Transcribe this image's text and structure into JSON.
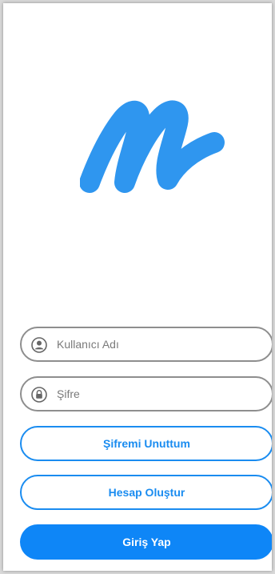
{
  "app": {
    "logo_icon": "m-logo-icon",
    "brand_color": "#2f96ef"
  },
  "login_form": {
    "username": {
      "placeholder": "Kullanıcı Adı",
      "icon": "user-circle-icon"
    },
    "password": {
      "placeholder": "Şifre",
      "icon": "lock-circle-icon"
    },
    "forgot_password_label": "Şifremi Unuttum",
    "create_account_label": "Hesap Oluştur",
    "login_label": "Giriş Yap"
  },
  "colors": {
    "accent": "#1a8cf0",
    "primary_button": "#0e86f7",
    "field_border": "#8e8e8e"
  }
}
